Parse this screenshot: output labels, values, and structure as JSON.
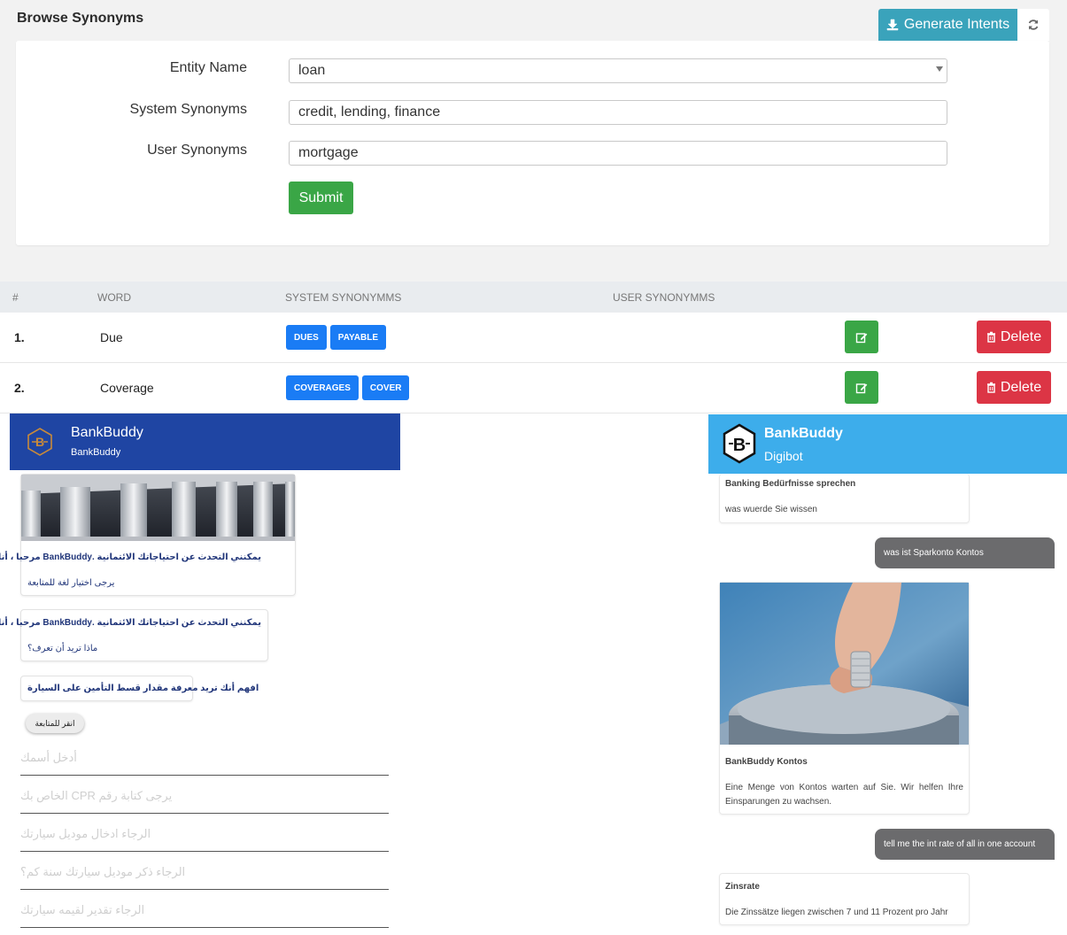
{
  "page": {
    "title": "Browse Synonyms",
    "generate_label": "Generate Intents",
    "submit_label": "Submit"
  },
  "form": {
    "entity_label": "Entity Name",
    "entity_value": "loan",
    "system_label": "System Synonyms",
    "system_value": "credit, lending, finance",
    "user_label": "User Synonyms",
    "user_value": "mortgage"
  },
  "table": {
    "headers": [
      "#",
      "WORD",
      "SYSTEM SYNONYMMS",
      "USER SYNONYMMS"
    ],
    "delete_label": "Delete",
    "rows": [
      {
        "num": "1.",
        "word": "Due",
        "tags": [
          "DUES",
          "PAYABLE"
        ]
      },
      {
        "num": "2.",
        "word": "Coverage",
        "tags": [
          "COVERAGES",
          "COVER"
        ]
      }
    ]
  },
  "left_chat": {
    "title": "BankBuddy",
    "subtitle": "BankBuddy",
    "header_color": "#1f45a3",
    "msg1_line1": "يمكنني التحدث عن احتياجاتك الائتمانية .BankBuddy مرحبا ، أنا مساعد",
    "msg1_line2": "يرجى اختيار لغة للمتابعة",
    "msg2_line1": "يمكنني التحدث عن احتياجاتك الائتمانية .BankBuddy مرحبا ، أنا مساعد",
    "msg2_line2": "ماذا تريد أن تعرف؟",
    "msg3": "افهم أنك تريد معرفة مقدار قسط التأمين على السيارة",
    "pill": "انقر للمتابعة",
    "fields": [
      "أدخل أسمك",
      "الخاص بك CPR يرجى كتابة رقم",
      "الرجاء ادخال موديل سيارتك",
      "الرجاء ذكر موديل سيارتك سنة كم؟",
      "الرجاء تقدير لقيمه سيارتك"
    ]
  },
  "right_chat": {
    "title": "BankBuddy",
    "subtitle": "Digibot",
    "header_color": "#3dadeb",
    "card1_title": "Banking Bedürfnisse sprechen",
    "card1_text": "was wuerde Sie wissen",
    "user1": "was ist Sparkonto Kontos",
    "card2_title": "BankBuddy Kontos",
    "card2_text": "Eine Menge von Kontos warten auf Sie. Wir helfen Ihre Einsparungen zu wachsen.",
    "user2": "tell me the int rate of all in one account",
    "card3_title": "Zinsrate",
    "card3_text": "Die Zinssätze liegen zwischen 7 und 11 Prozent pro Jahr"
  },
  "icons": {
    "generate": "download-icon",
    "refresh": "refresh-icon",
    "edit": "edit-icon",
    "delete": "trash-icon",
    "select_caret": "chevron-down-icon"
  },
  "colors": {
    "accent": "#3aa3bb",
    "success": "#3aa646",
    "danger": "#dc3545",
    "tag": "#1a7cf5"
  }
}
